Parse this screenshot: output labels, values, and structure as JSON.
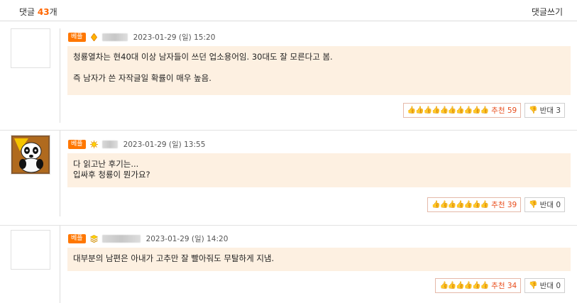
{
  "header": {
    "label": "댓글",
    "count": "43",
    "suffix": "개",
    "write_label": "댓글쓰기"
  },
  "colors": {
    "accent": "#ff6600",
    "best_badge": "#ff7700",
    "comment_bg": "#fdf0e1",
    "upvote": "#e84d1c"
  },
  "comments": [
    {
      "badge": "베플",
      "level_icon": "diamond-level-icon",
      "date": "2023-01-29 (일) 15:20",
      "lines": [
        "청룡열차는 현40대 이상 남자들이 쓰던 업소용어임. 30대도 잘 모른다고 봄.",
        "",
        "즉 남자가 쓴 자작글일 확률이 매우 높음."
      ],
      "up_thumbs": "👍👍👍👍👍👍👍👍👍👍",
      "up_label": "추천 59",
      "down_label": "반대 3",
      "avatar": "empty"
    },
    {
      "badge": "베플",
      "level_icon": "sun-level-icon",
      "date": "2023-01-29 (일) 13:55",
      "lines": [
        "다 읽고난 후기는...",
        "입싸후 청룡이 뭔가요?"
      ],
      "up_thumbs": "👍👍👍👍👍👍👍",
      "up_label": "추천 39",
      "down_label": "반대 0",
      "avatar": "panda-icon"
    },
    {
      "badge": "베플",
      "level_icon": "stack-level-icon",
      "date": "2023-01-29 (일) 14:20",
      "lines": [
        "대부분의 남편은 아내가 고추만 잘 빨아줘도 무탈하게 지냄."
      ],
      "up_thumbs": "👍👍👍👍👍👍",
      "up_label": "추천 34",
      "down_label": "반대 0",
      "avatar": "empty"
    }
  ]
}
